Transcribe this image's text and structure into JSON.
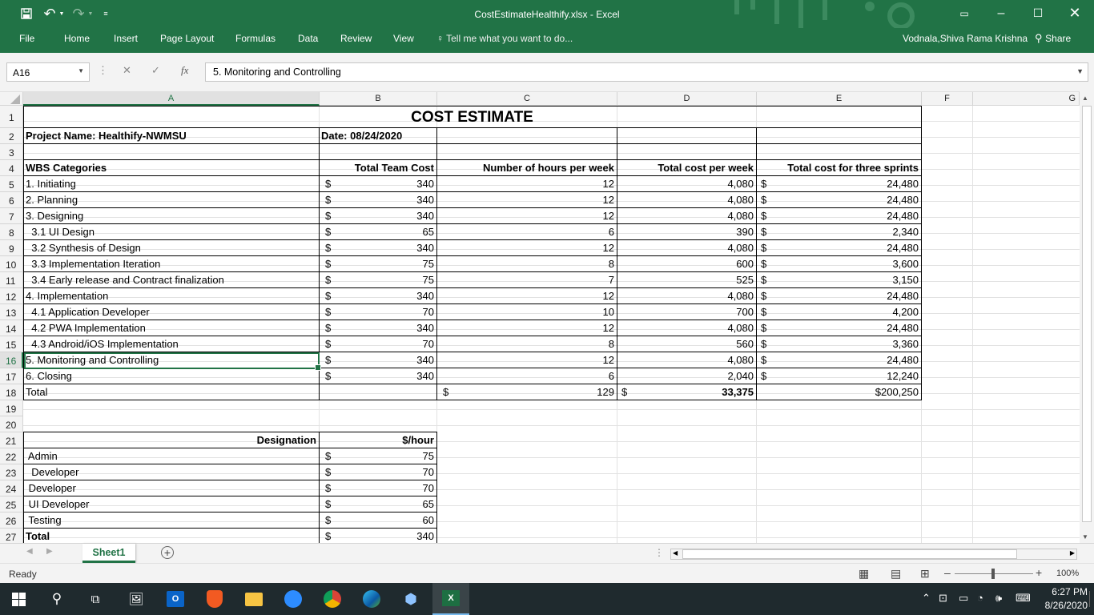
{
  "window": {
    "title": "CostEstimateHealthify.xlsx - Excel",
    "undo": "↶",
    "redo": "↷"
  },
  "menu": {
    "tabs": [
      "File",
      "Home",
      "Insert",
      "Page Layout",
      "Formulas",
      "Data",
      "Review",
      "View"
    ],
    "tell_me": "Tell me what you want to do...",
    "user": "Vodnala,Shiva Rama Krishna",
    "share": "Share"
  },
  "formula_bar": {
    "name_box": "A16",
    "content": "5. Monitoring and Controlling",
    "fx": "fx"
  },
  "columns": [
    "A",
    "B",
    "C",
    "D",
    "E",
    "F",
    "G"
  ],
  "rows": [
    "1",
    "2",
    "3",
    "4",
    "5",
    "6",
    "7",
    "8",
    "9",
    "10",
    "11",
    "12",
    "13",
    "14",
    "15",
    "16",
    "17",
    "18",
    "19",
    "20",
    "21",
    "22",
    "23",
    "24",
    "25",
    "26",
    "27"
  ],
  "sheet": {
    "title": "COST ESTIMATE",
    "project_name": "Project Name: Healthify-NWMSU",
    "date": "Date: 08/24/2020",
    "headers": [
      "WBS Categories",
      "Total Team Cost",
      "Number of hours per week",
      "Total cost per week",
      "Total cost for three sprints"
    ],
    "wbs_rows": [
      {
        "name": "1. Initiating",
        "cost": "340",
        "hours": "12",
        "week": "4,080",
        "sprints": "24,480"
      },
      {
        "name": "2. Planning",
        "cost": "340",
        "hours": "12",
        "week": "4,080",
        "sprints": "24,480"
      },
      {
        "name": "3. Designing",
        "cost": "340",
        "hours": "12",
        "week": "4,080",
        "sprints": "24,480"
      },
      {
        "name": "  3.1 UI Design",
        "cost": "65",
        "hours": "6",
        "week": "390",
        "sprints": "2,340"
      },
      {
        "name": "  3.2 Synthesis of Design",
        "cost": "340",
        "hours": "12",
        "week": "4,080",
        "sprints": "24,480"
      },
      {
        "name": "  3.3 Implementation Iteration",
        "cost": "75",
        "hours": "8",
        "week": "600",
        "sprints": "3,600"
      },
      {
        "name": "  3.4 Early release and Contract finalization",
        "cost": "75",
        "hours": "7",
        "week": "525",
        "sprints": "3,150"
      },
      {
        "name": "4. Implementation",
        "cost": "340",
        "hours": "12",
        "week": "4,080",
        "sprints": "24,480"
      },
      {
        "name": "  4.1 Application Developer",
        "cost": "70",
        "hours": "10",
        "week": "700",
        "sprints": "4,200"
      },
      {
        "name": "  4.2 PWA Implementation",
        "cost": "340",
        "hours": "12",
        "week": "4,080",
        "sprints": "24,480"
      },
      {
        "name": "  4.3 Android/iOS Implementation",
        "cost": "70",
        "hours": "8",
        "week": "560",
        "sprints": "3,360"
      },
      {
        "name": "5. Monitoring and Controlling",
        "cost": "340",
        "hours": "12",
        "week": "4,080",
        "sprints": "24,480"
      },
      {
        "name": "6. Closing",
        "cost": "340",
        "hours": "6",
        "week": "2,040",
        "sprints": "12,240"
      }
    ],
    "total": {
      "label": "Total",
      "hours": "129",
      "week": "33,375",
      "sprints": "$200,250"
    },
    "currency": "$",
    "rates_headers": [
      "Designation",
      "$/hour"
    ],
    "rates": [
      {
        "name": " Admin",
        "rate": "75"
      },
      {
        "name": "  Developer",
        "rate": "70"
      },
      {
        "name": " Developer",
        "rate": "70"
      },
      {
        "name": " UI Developer",
        "rate": "65"
      },
      {
        "name": " Testing",
        "rate": "60"
      }
    ],
    "rates_total": {
      "label": "Total",
      "rate": "340"
    }
  },
  "sheet_tab": "Sheet1",
  "status": {
    "ready": "Ready",
    "zoom": "100%"
  },
  "taskbar": {
    "time": "6:27 PM",
    "date": "8/26/2020"
  },
  "colors": {
    "excel_green": "#217346",
    "taskbar": "#1f2a2e"
  }
}
